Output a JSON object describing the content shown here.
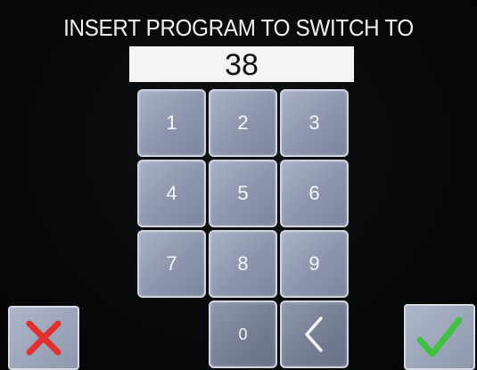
{
  "header": {
    "title": "INSERT PROGRAM TO SWITCH TO"
  },
  "display": {
    "value": "38"
  },
  "keypad": {
    "keys": [
      "1",
      "2",
      "3",
      "4",
      "5",
      "6",
      "7",
      "8",
      "9",
      "0"
    ],
    "backspace_icon": "chevron-left-icon"
  },
  "actions": {
    "cancel_icon": "close-icon",
    "cancel_color": "#e2302e",
    "confirm_icon": "checkmark-icon",
    "confirm_color": "#3fc23f"
  }
}
